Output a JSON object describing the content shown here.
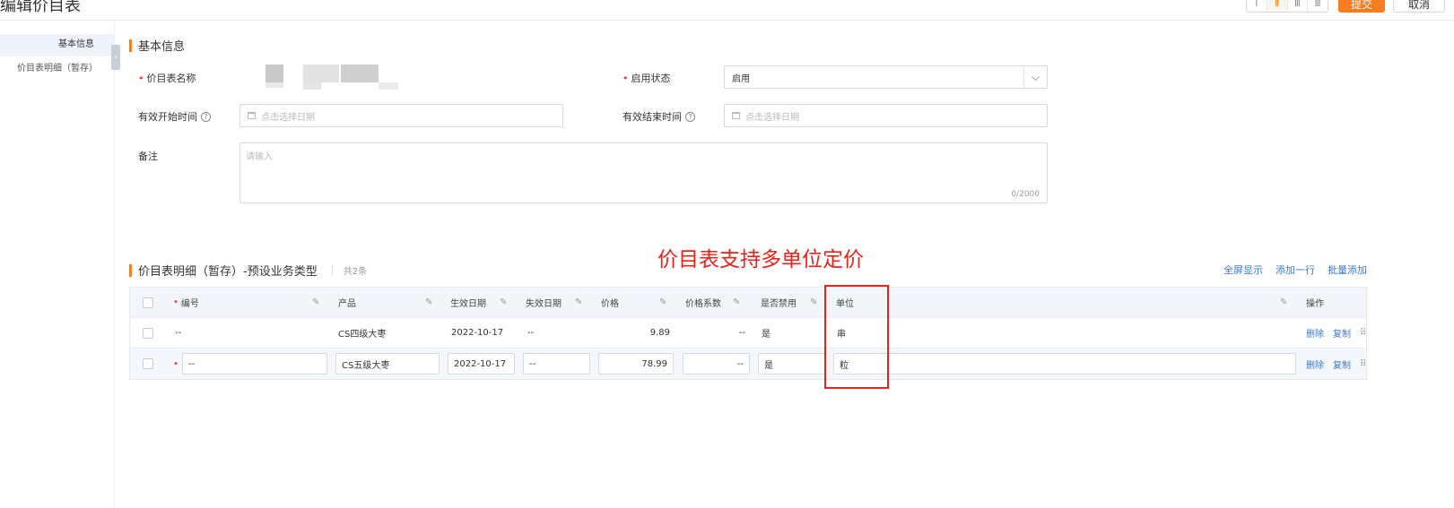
{
  "header": {
    "title": "编辑价目表",
    "layout_options": [
      "Ⅰ",
      "Ⅱ",
      "Ⅲ",
      "Ⅲ"
    ],
    "submit_label": "提交",
    "cancel_label": "取消"
  },
  "sidebar": {
    "items": [
      {
        "label": "基本信息",
        "active": true
      },
      {
        "label": "价目表明细（暂存）",
        "active": false
      }
    ]
  },
  "basic_section": {
    "title": "基本信息",
    "name_label": "价目表名称",
    "status_label": "启用状态",
    "status_value": "启用",
    "start_label": "有效开始时间",
    "start_placeholder": "点击选择日期",
    "end_label": "有效结束时间",
    "end_placeholder": "点击选择日期",
    "remark_label": "备注",
    "remark_placeholder": "请输入",
    "remark_counter": "0/2000"
  },
  "annotation": "价目表支持多单位定价",
  "detail_section": {
    "title": "价目表明细（暂存）-预设业务类型",
    "count": "共2条",
    "actions": [
      "全屏显示",
      "添加一行",
      "批量添加"
    ]
  },
  "table": {
    "columns": [
      "编号",
      "产品",
      "生效日期",
      "失效日期",
      "价格",
      "价格系数",
      "是否禁用",
      "单位",
      "操作"
    ],
    "rows": [
      {
        "code": "--",
        "product": "CS四级大枣",
        "start": "2022-10-17",
        "end": "--",
        "price": "9.89",
        "coef": "--",
        "disabled": "是",
        "unit": "串",
        "ops": [
          "删除",
          "复制"
        ]
      },
      {
        "code": "--",
        "product": "CS五级大枣",
        "start": "2022-10-17",
        "end": "--",
        "price": "78.99",
        "coef": "--",
        "disabled": "是",
        "unit": "粒",
        "ops": [
          "删除",
          "复制"
        ]
      }
    ]
  }
}
